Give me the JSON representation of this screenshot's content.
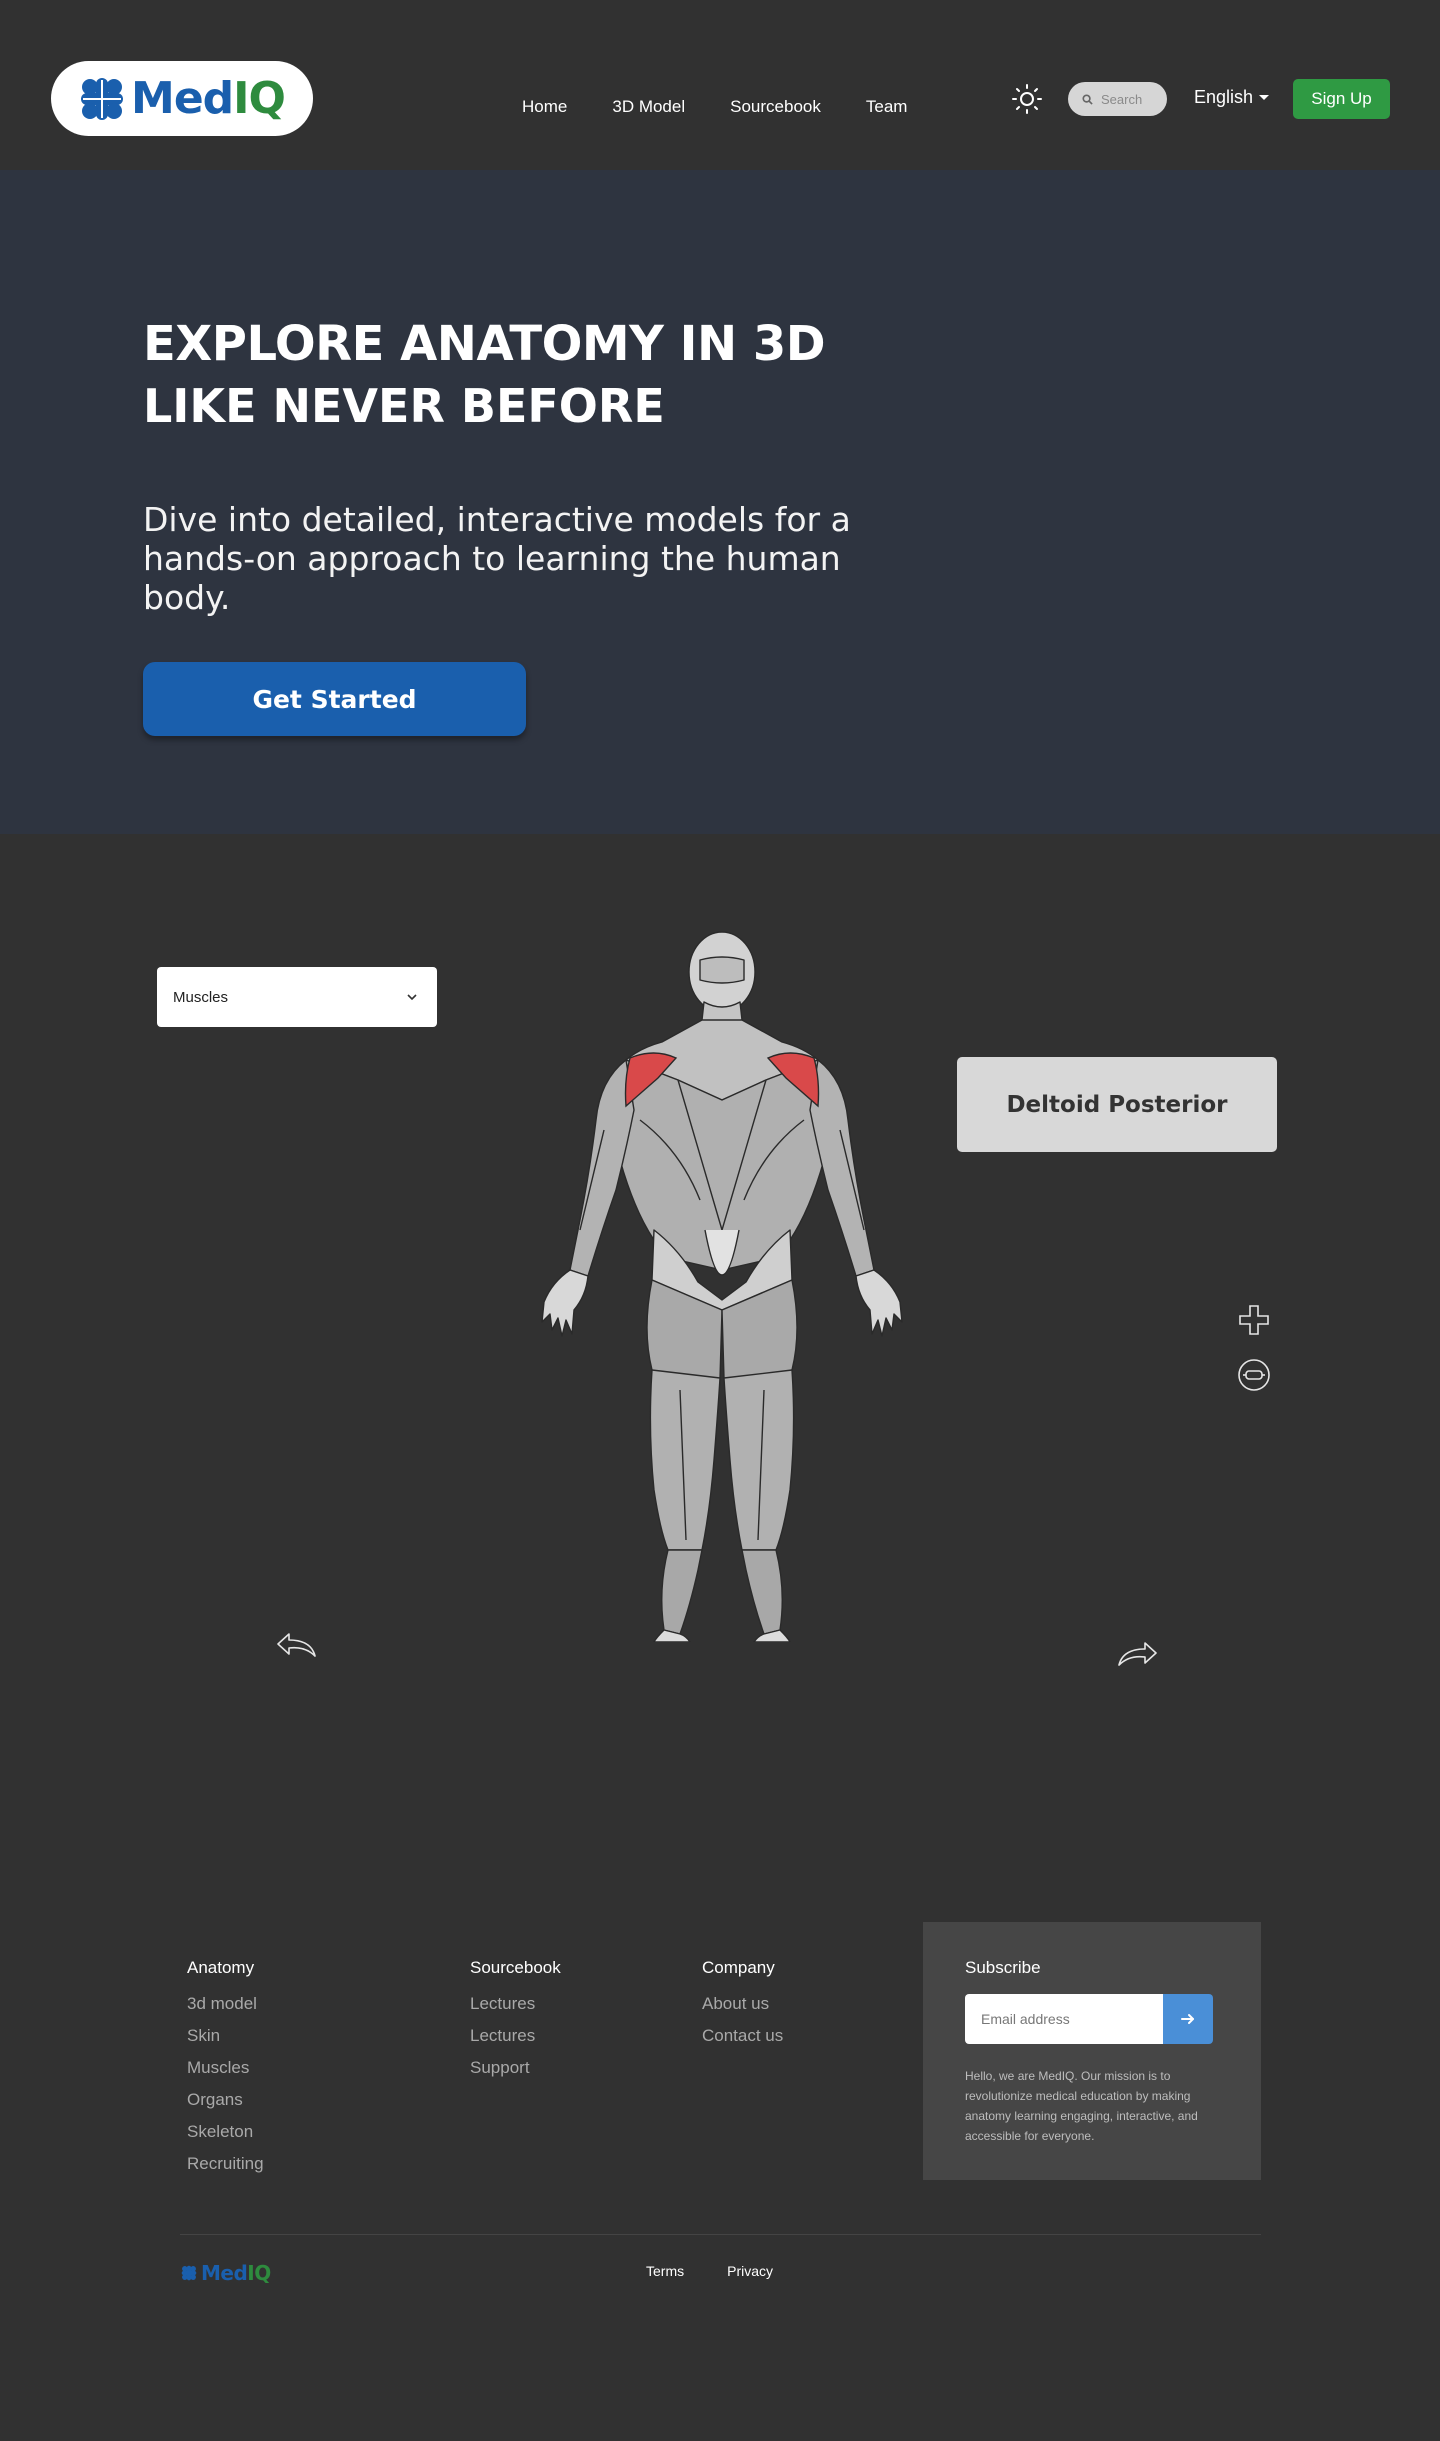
{
  "nav": {
    "logo": {
      "part1": "Med",
      "part2": "IQ"
    },
    "links": [
      "Home",
      "3D Model",
      "Sourcebook",
      "Team"
    ],
    "search_placeholder": "Search",
    "language": "English",
    "signup_label": "Sign Up"
  },
  "hero": {
    "title": "EXPLORE ANATOMY IN 3D",
    "subtitle": "LIKE NEVER BEFORE",
    "description": "Dive into detailed, interactive models for a hands-on approach to learning the human body.",
    "cta_label": "Get Started"
  },
  "model": {
    "layer_select": "Muscles",
    "selected_muscle": "Deltoid Posterior",
    "highlight_color": "#d9494a"
  },
  "footer": {
    "columns": [
      {
        "heading": "Anatomy",
        "links": [
          "3d model",
          "Skin",
          "Muscles",
          "Organs",
          "Skeleton",
          "Recruiting"
        ]
      },
      {
        "heading": "Sourcebook",
        "links": [
          "Lectures",
          "Lectures",
          "Support"
        ]
      },
      {
        "heading": "Company",
        "links": [
          "About us",
          "Contact us"
        ]
      }
    ],
    "subscribe": {
      "heading": "Subscribe",
      "email_placeholder": "Email address",
      "text": "Hello, we are MedIQ. Our mission is to revolutionize medical education by making anatomy learning engaging, interactive, and accessible for everyone."
    },
    "logo": {
      "part1": "Med",
      "part2": "IQ"
    },
    "legal": [
      "Terms",
      "Privacy"
    ]
  },
  "colors": {
    "brand_blue": "#1a5fad",
    "brand_green": "#2e8b3e",
    "signup_green": "#2f9a43",
    "hero_bg": "#2e3440",
    "page_bg": "#313131",
    "submit_blue": "#4a8fd7"
  },
  "icons": [
    "medical-cross-logo-icon",
    "sun-icon",
    "search-icon",
    "chevron-down-icon",
    "zoom-in-icon",
    "reset-view-icon",
    "rotate-left-icon",
    "rotate-right-icon",
    "arrow-right-icon"
  ]
}
